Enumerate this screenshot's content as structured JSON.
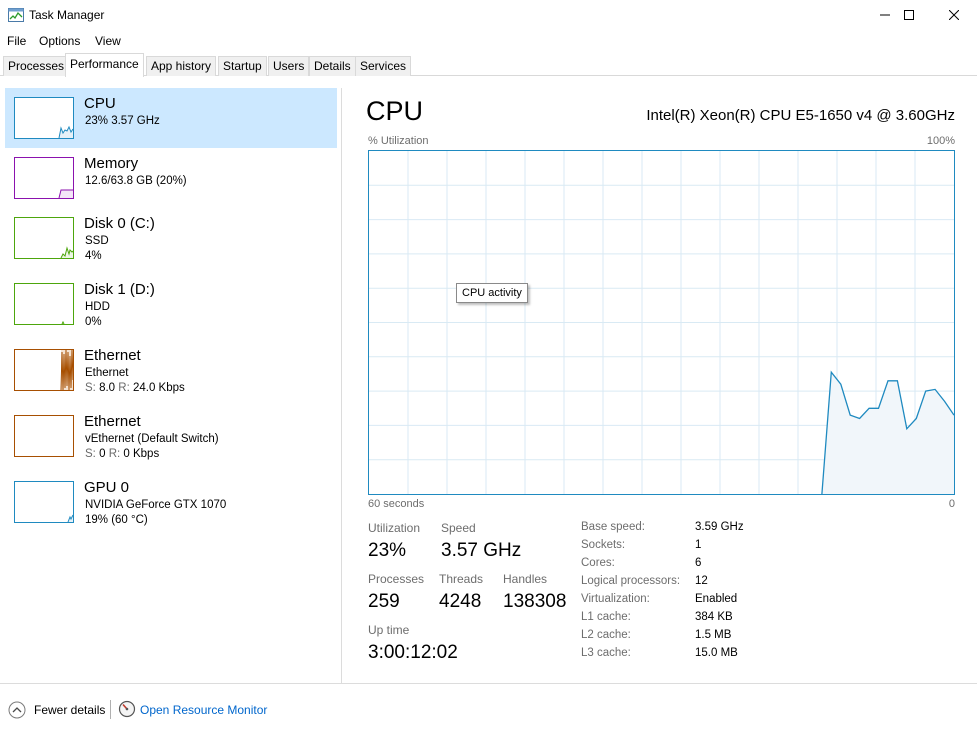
{
  "window": {
    "title": "Task Manager"
  },
  "menu": [
    "File",
    "Options",
    "View"
  ],
  "tabs": [
    "Processes",
    "Performance",
    "App history",
    "Startup",
    "Users",
    "Details",
    "Services"
  ],
  "active_tab": "Performance",
  "resources": [
    {
      "name": "CPU",
      "line1": "23% 3.57 GHz",
      "line2": "",
      "color": "#1f8ac0",
      "selected": true
    },
    {
      "name": "Memory",
      "line1": "12.6/63.8 GB (20%)",
      "line2": "",
      "color": "#8b12ae"
    },
    {
      "name": "Disk 0 (C:)",
      "line1": "SSD",
      "line2": "4%",
      "color": "#4da60c"
    },
    {
      "name": "Disk 1 (D:)",
      "line1": "HDD",
      "line2": "0%",
      "color": "#4da60c"
    },
    {
      "name": "Ethernet",
      "line1": "Ethernet",
      "line2_s": "S:",
      "line2_s_val": "8.0",
      "line2_r": "R:",
      "line2_r_val": "24.0 Kbps",
      "color": "#a74f01"
    },
    {
      "name": "Ethernet",
      "line1": "vEthernet (Default Switch)",
      "line2_s": "S:",
      "line2_s_val": "0",
      "line2_r": "R:",
      "line2_r_val": "0 Kbps",
      "color": "#a74f01"
    },
    {
      "name": "GPU 0",
      "line1": "NVIDIA GeForce GTX 1070",
      "line2": "19% (60 °C)",
      "color": "#1f8ac0"
    }
  ],
  "detail": {
    "title": "CPU",
    "model": "Intel(R) Xeon(R) CPU E5-1650 v4 @ 3.60GHz",
    "util_label": "% Utilization",
    "util_max": "100%",
    "axis_left": "60 seconds",
    "axis_right": "0",
    "tooltip": "CPU activity",
    "stats": {
      "utilization_label": "Utilization",
      "utilization": "23%",
      "speed_label": "Speed",
      "speed": "3.57 GHz",
      "processes_label": "Processes",
      "processes": "259",
      "threads_label": "Threads",
      "threads": "4248",
      "handles_label": "Handles",
      "handles": "138308",
      "uptime_label": "Up time",
      "uptime": "3:00:12:02"
    },
    "specs": [
      {
        "label": "Base speed:",
        "value": "3.59 GHz"
      },
      {
        "label": "Sockets:",
        "value": "1"
      },
      {
        "label": "Cores:",
        "value": "6"
      },
      {
        "label": "Logical processors:",
        "value": "12"
      },
      {
        "label": "Virtualization:",
        "value": "Enabled"
      },
      {
        "label": "L1 cache:",
        "value": "384 KB"
      },
      {
        "label": "L2 cache:",
        "value": "1.5 MB"
      },
      {
        "label": "L3 cache:",
        "value": "15.0 MB"
      }
    ]
  },
  "cpu_history": {
    "seconds_visible": 60,
    "max": 100,
    "samples": [
      0,
      0,
      0,
      0,
      0,
      0,
      0,
      0,
      0,
      0,
      0,
      0,
      0,
      0,
      0,
      0,
      0,
      0,
      0,
      0,
      0,
      0,
      0,
      0,
      0,
      0,
      0,
      0,
      0,
      0,
      0,
      0,
      0,
      0,
      0,
      0,
      0,
      0,
      0,
      0,
      0,
      0,
      0,
      0,
      0,
      0,
      0,
      0,
      0,
      35.5,
      32,
      23,
      22,
      25,
      25,
      33,
      33,
      19,
      22,
      30,
      30.5,
      27,
      23
    ]
  },
  "footer": {
    "fewer_details": "Fewer details",
    "open_resource_monitor": "Open Resource Monitor"
  },
  "accent": "#1f8ac0",
  "selected_bg": "#cce8ff"
}
